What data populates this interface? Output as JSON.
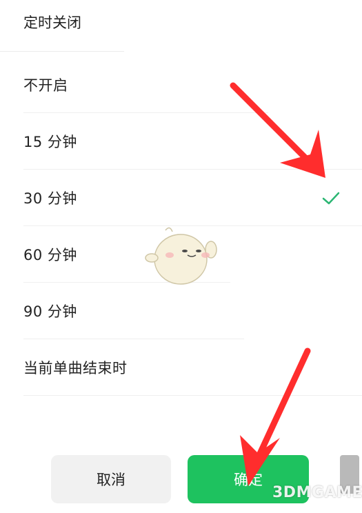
{
  "dialog": {
    "title": "定时关闭",
    "options": [
      {
        "label": "不开启",
        "selected": false
      },
      {
        "label": "15 分钟",
        "selected": false
      },
      {
        "label": "30 分钟",
        "selected": true
      },
      {
        "label": "60 分钟",
        "selected": false
      },
      {
        "label": "90 分钟",
        "selected": false
      },
      {
        "label": "当前单曲结束时",
        "selected": false
      }
    ],
    "cancel_label": "取消",
    "confirm_label": "确定"
  },
  "watermark": {
    "text": "3DMGAME"
  },
  "colors": {
    "accent": "#1ec25f",
    "check": "#2bb673",
    "arrow": "#ff2d2d"
  },
  "icons": {
    "check": "check-icon",
    "arrow": "red-arrow-annotation",
    "mascot": "mascot-sticker"
  }
}
